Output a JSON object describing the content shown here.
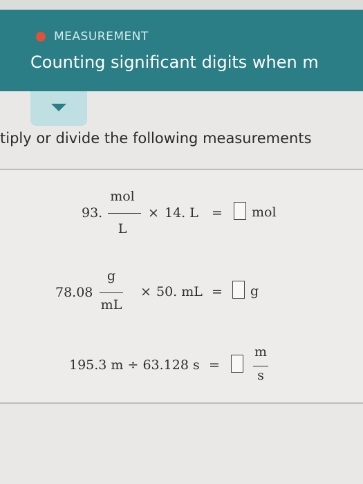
{
  "header": {
    "category": "MEASUREMENT",
    "title": "Counting significant digits when m"
  },
  "instruction": "tiply or divide the following measurements",
  "problems": [
    {
      "coefficient": "93.",
      "numerator": "mol",
      "denominator": "L",
      "operator": "×",
      "operand": "14. L",
      "equals": "=",
      "answer": "",
      "unit": "mol"
    },
    {
      "coefficient": "78.08",
      "numerator": "g",
      "denominator": "mL",
      "operator": "×",
      "operand": "50. mL",
      "equals": "=",
      "answer": "",
      "unit": "g"
    },
    {
      "expression": "195.3 m ÷ 63.128 s",
      "equals": "=",
      "answer": "",
      "unit_numerator": "m",
      "unit_denominator": "s"
    }
  ],
  "colors": {
    "header_teal": "#2b7e86",
    "category_dot": "#e2503a",
    "collapse_tab": "#bfdfe2"
  }
}
